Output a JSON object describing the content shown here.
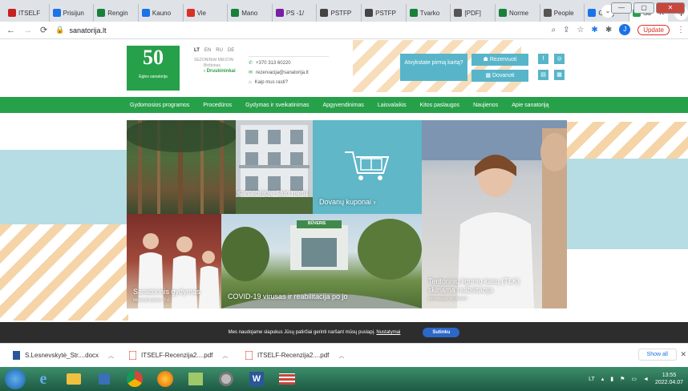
{
  "browser": {
    "tabs": [
      {
        "label": "ITSELF",
        "color": "#c5221f"
      },
      {
        "label": "Prisijun",
        "color": "#1a73e8"
      },
      {
        "label": "Rengin",
        "color": "#188038"
      },
      {
        "label": "Kauno",
        "color": "#1a73e8"
      },
      {
        "label": "Vie",
        "color": "#d93025"
      },
      {
        "label": "Mano",
        "color": "#188038"
      },
      {
        "label": "PS -1/",
        "color": "#7b1fa2"
      },
      {
        "label": "PSTFP",
        "color": "#444444"
      },
      {
        "label": "PSTFP",
        "color": "#444444"
      },
      {
        "label": "Tvarko",
        "color": "#188038"
      },
      {
        "label": "[PDF]",
        "color": "#555555"
      },
      {
        "label": "Norme",
        "color": "#188038"
      },
      {
        "label": "People",
        "color": "#555555"
      },
      {
        "label": "Goog",
        "color": "#1a73e8"
      },
      {
        "label": "Sa",
        "color": "#27a04a",
        "active": true
      }
    ],
    "url": "sanatorija.lt",
    "update_label": "Update",
    "avatar_letter": "J"
  },
  "site": {
    "logo": {
      "number": "50",
      "subtitle": "Egles sanatorija"
    },
    "languages": [
      "LT",
      "EN",
      "RU",
      "DE"
    ],
    "seasons_label": "SEZONINIAI MIESTAI",
    "season_names": [
      "Birštonas",
      "Druskininkai"
    ],
    "contacts": [
      "+370 313 60220",
      "rezervacija@sanatorija.lt",
      "Kaip mus rasti?"
    ],
    "visit_box": "Atvykstate pirmą kartą?",
    "reserve_label": "Rezervuoti",
    "gift_label": "Dovanoti",
    "nav": [
      "Gydomosios programos",
      "Procedūros",
      "Gydymas ir sveikatinimas",
      "Apgyvendinimas",
      "Laisvalaikis",
      "Kitos paslaugos",
      "Naujienos",
      "Apie sanatoriją"
    ],
    "tiles": {
      "duk": "DUK: kaip organizuojama veikla sanatorijoje šiuo metu",
      "gift": "Dovanų kuponai ›",
      "tlk_title": "Teritorinių ligonių kasų (TLK) skiriama reabilitacija",
      "tlk_sub": "Informacija atvykstant",
      "treatment_title": "Sanatorinis gydymas",
      "treatment_sub": "Minimali trukmė: 3 d.",
      "covid": "COVID-19 virusas ir reabilitacija po jo",
      "building_sign": "BŪVERIS"
    },
    "cookie": {
      "text": "Mes naudojame slapukus Jūsų patirčiai gerinti naršant mūsų puslapį.",
      "link": "Nustatymai",
      "button": "Sutinku"
    }
  },
  "downloads": {
    "items": [
      "S.Lesnevskytė_Str....docx",
      "ITSELF-Recenzija2....pdf",
      "ITSELF-Recenzija2....pdf"
    ],
    "show_all": "Show all"
  },
  "taskbar": {
    "lang": "LT",
    "time": "13:55",
    "date": "2022.04.07"
  }
}
